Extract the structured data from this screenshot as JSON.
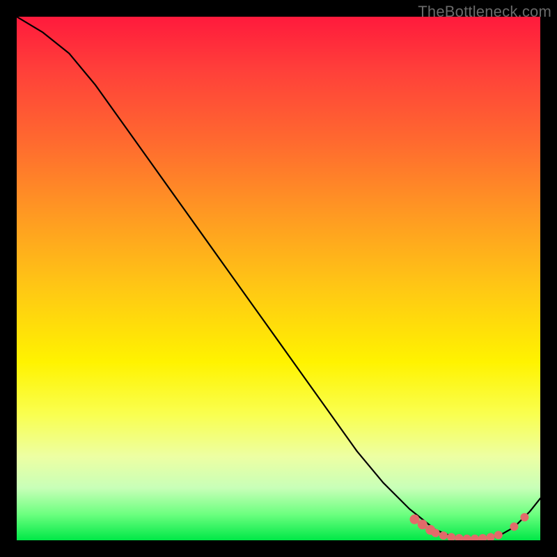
{
  "watermark": "TheBottleneck.com",
  "chart_data": {
    "type": "line",
    "title": "",
    "xlabel": "",
    "ylabel": "",
    "xlim": [
      0,
      100
    ],
    "ylim": [
      0,
      100
    ],
    "grid": false,
    "series": [
      {
        "name": "curve",
        "color": "#000000",
        "x": [
          0,
          5,
          10,
          15,
          20,
          25,
          30,
          35,
          40,
          45,
          50,
          55,
          60,
          65,
          70,
          75,
          80,
          83,
          86,
          89,
          92,
          95,
          98,
          100
        ],
        "y": [
          100,
          97,
          93,
          87,
          80,
          73,
          66,
          59,
          52,
          45,
          38,
          31,
          24,
          17,
          11,
          6,
          2,
          0.8,
          0.3,
          0.3,
          0.8,
          2.5,
          5.5,
          8
        ]
      }
    ],
    "markers": [
      {
        "x": 76.0,
        "y": 4.0,
        "r": 7
      },
      {
        "x": 77.5,
        "y": 3.0,
        "r": 7
      },
      {
        "x": 79.0,
        "y": 2.0,
        "r": 7
      },
      {
        "x": 80.0,
        "y": 1.4,
        "r": 6
      },
      {
        "x": 81.5,
        "y": 0.9,
        "r": 6
      },
      {
        "x": 83.0,
        "y": 0.6,
        "r": 6
      },
      {
        "x": 84.5,
        "y": 0.4,
        "r": 6
      },
      {
        "x": 86.0,
        "y": 0.3,
        "r": 6
      },
      {
        "x": 87.5,
        "y": 0.3,
        "r": 6
      },
      {
        "x": 89.0,
        "y": 0.4,
        "r": 6
      },
      {
        "x": 90.5,
        "y": 0.6,
        "r": 6
      },
      {
        "x": 92.0,
        "y": 1.0,
        "r": 6
      },
      {
        "x": 95.0,
        "y": 2.6,
        "r": 6
      },
      {
        "x": 97.0,
        "y": 4.4,
        "r": 6
      }
    ],
    "marker_color": "#e26a6a"
  }
}
